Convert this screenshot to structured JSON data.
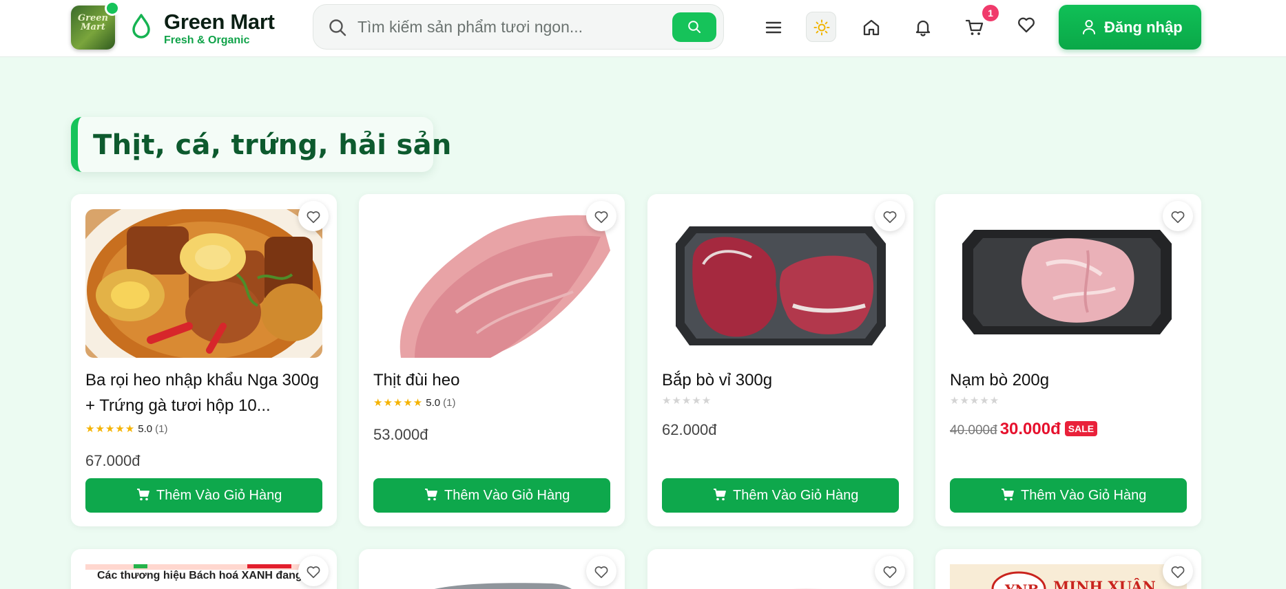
{
  "header": {
    "logo_text": "Green Mart",
    "brand_name": "Green Mart",
    "brand_tagline": "Fresh & Organic",
    "search_placeholder": "Tìm kiếm sản phẩm tươi ngon...",
    "cart_count": "1",
    "login_label": "Đăng nhập"
  },
  "section": {
    "title": "Thịt, cá, trứng, hải sản"
  },
  "products": [
    {
      "name": "Ba rọi heo nhập khẩu Nga 300g + Trứng gà tươi hộp 10...",
      "rating": "5.0",
      "rating_count": "(1)",
      "price": "67.000đ",
      "add_label": "Thêm Vào Giỏ Hàng"
    },
    {
      "name": "Thịt đùi heo",
      "rating": "5.0",
      "rating_count": "(1)",
      "price": "53.000đ",
      "add_label": "Thêm Vào Giỏ Hàng"
    },
    {
      "name": "Bắp bò vỉ 300g",
      "price": "62.000đ",
      "add_label": "Thêm Vào Giỏ Hàng"
    },
    {
      "name": "Nạm bò 200g",
      "old_price": "40.000đ",
      "sale_price": "30.000đ",
      "sale_badge": "SALE",
      "add_label": "Thêm Vào Giỏ Hàng"
    }
  ],
  "row2": {
    "card1_text": "Các thương hiệu Bách hoá XANH đang bá",
    "card4_text": "MINH XUÂN"
  },
  "colors": {
    "accent": "#16c35a",
    "button": "#0ea84c",
    "sale": "#e6112d",
    "title": "#0d5a2e",
    "background": "#ecfbf2"
  },
  "icons": [
    "drop-icon",
    "search-icon",
    "menu-icon",
    "sun-icon",
    "home-icon",
    "bell-icon",
    "cart-icon",
    "heart-icon",
    "user-icon",
    "star-icon"
  ]
}
